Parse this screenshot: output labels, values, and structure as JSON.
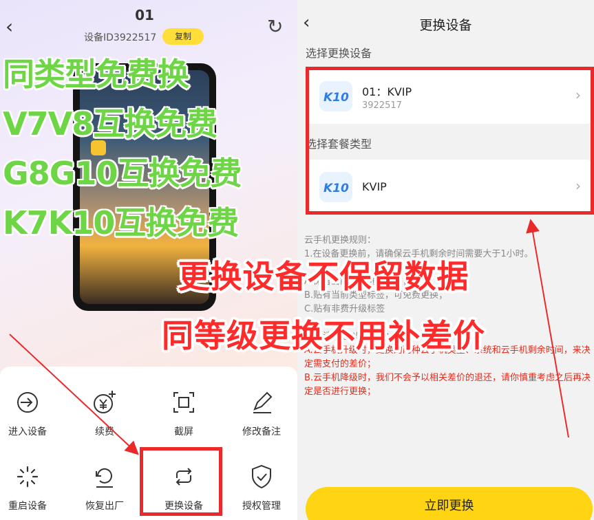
{
  "left": {
    "title": "01",
    "device_id": "设备ID3922517",
    "copy_label": "复制",
    "promo_lines": [
      "同类型免费换",
      "V7V8互换免费",
      "G8G10互换免费",
      "K7K10互换免费"
    ],
    "actions": [
      {
        "label": "进入设备",
        "icon": "enter-icon"
      },
      {
        "label": "续费",
        "icon": "yen-plus-icon"
      },
      {
        "label": "截屏",
        "icon": "screenshot-icon"
      },
      {
        "label": "修改备注",
        "icon": "edit-icon"
      },
      {
        "label": "重启设备",
        "icon": "restart-icon"
      },
      {
        "label": "恢复出厂",
        "icon": "restore-icon"
      },
      {
        "label": "更换设备",
        "icon": "swap-icon"
      },
      {
        "label": "授权管理",
        "icon": "shield-check-icon"
      }
    ]
  },
  "right": {
    "title": "更换设备",
    "section_device": "选择更换设备",
    "device_card": {
      "logo": "K10",
      "name": "01：KVIP",
      "id": "3922517"
    },
    "section_plan": "选择套餐类型",
    "plan_card": {
      "logo": "K10",
      "name": "KVIP"
    },
    "rules_title": "云手机更换规则：",
    "rules_gray": [
      "1.在设备更换前，请确保云手机剩余时间需要大于1小时。",
      "A.保留当前数据进行更换；",
      "B.贴有当前类型标签，可免费更换；",
      "C.贴有非费升级标签",
      "D.以请注意以下几点："
    ],
    "rules_red": [
      "A.云手机升级时，更换的两种云手机类型、系统和云手机剩余时间，来决定需支付的差价；",
      "B.云手机降级时，我们不会予以相关差价的退还，请你慎重考虑之后再决定是否进行更换；"
    ],
    "confirm_label": "立即更换"
  },
  "overlay": {
    "red_lines": [
      "更换设备不保留数据",
      "同等级更换不用补差价"
    ]
  },
  "colors": {
    "accent": "#ffd413",
    "highlight": "#ea2a2a",
    "promo_green": "#6ed646"
  }
}
